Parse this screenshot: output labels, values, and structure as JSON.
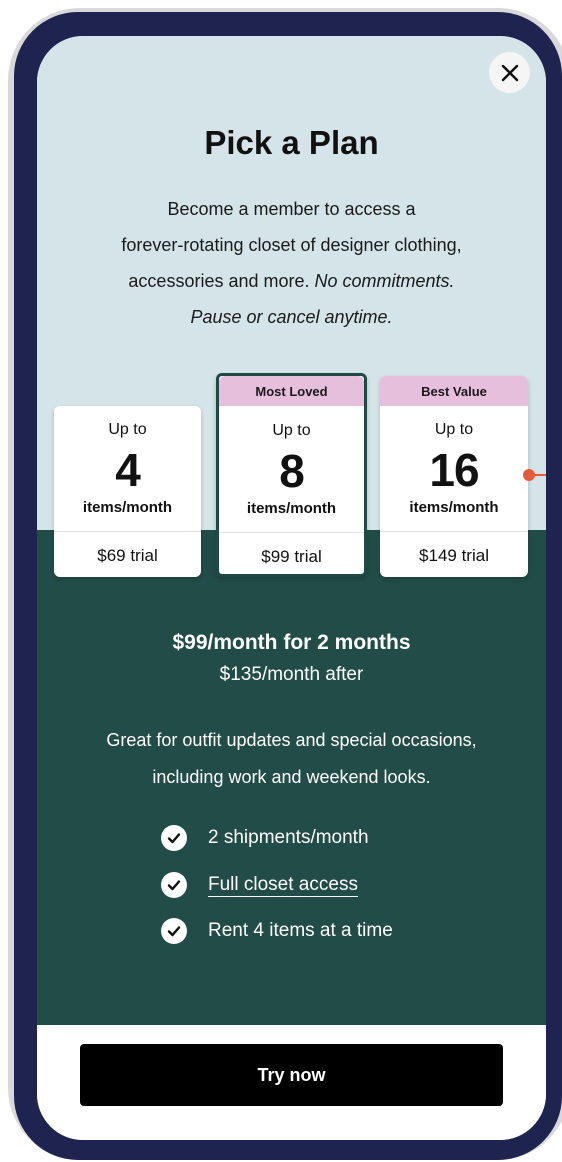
{
  "header": {
    "close_icon": "close-icon",
    "title": "Pick a Plan",
    "subtitle_line1": "Become a member to access a",
    "subtitle_line2": "forever-rotating closet of designer clothing,",
    "subtitle_line3_plain": "accessories and more.",
    "subtitle_line3_italic": "No commitments.",
    "subtitle_line4_italic": "Pause or cancel anytime."
  },
  "plans": [
    {
      "badge": "",
      "up_to": "Up to",
      "count": "4",
      "unit": "items/month",
      "price": "$69 trial",
      "selected": false
    },
    {
      "badge": "Most Loved",
      "up_to": "Up to",
      "count": "8",
      "unit": "items/month",
      "price": "$99 trial",
      "selected": true
    },
    {
      "badge": "Best Value",
      "up_to": "Up to",
      "count": "16",
      "unit": "items/month",
      "price": "$149 trial",
      "selected": false
    }
  ],
  "details": {
    "price_main": "$99/month for 2 months",
    "price_after": "$135/month after",
    "description_line1": "Great for outfit updates and special occasions,",
    "description_line2": "including work and weekend looks."
  },
  "features": [
    {
      "icon": "check-icon",
      "text": "2 shipments/month",
      "link": false
    },
    {
      "icon": "check-icon",
      "text": "Full closet access",
      "link": true
    },
    {
      "icon": "check-icon",
      "text": "Rent 4 items at a time",
      "link": false
    }
  ],
  "cta": {
    "label": "Try now"
  },
  "colors": {
    "frame": "#1f2350",
    "top_background": "#d4e4e8",
    "panel_green": "#224c47",
    "badge_pink": "#e6bfdc",
    "annotation_marker": "#e55b3a",
    "cta_background": "#000000"
  }
}
